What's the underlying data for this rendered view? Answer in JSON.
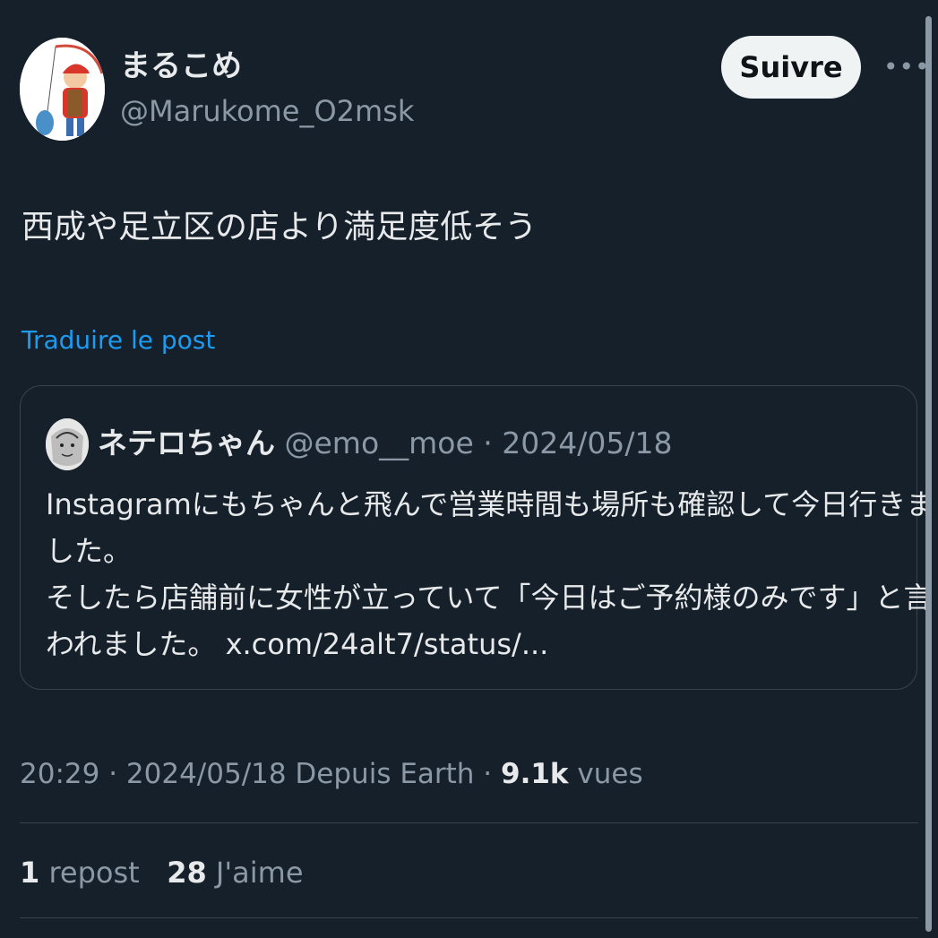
{
  "author": {
    "display_name": "まるこめ",
    "handle": "@Marukome_O2msk"
  },
  "follow_label": "Suivre",
  "more_icon": "more-horizontal-icon",
  "tweet": {
    "text": "西成や足立区の店より満足度低そう",
    "translate_label": "Traduire le post"
  },
  "quoted": {
    "display_name": "ネテロちゃん",
    "handle": "@emo__moe",
    "separator": " · ",
    "date": "2024/05/18",
    "lines": [
      "Instagramにもちゃんと飛んで営業時間も場所も確認して今日行きま",
      "した。",
      "そしたら店舗前に女性が立っていて「今日はご予約様のみです」と言",
      "われました。 x.com/24alt7/status/..."
    ]
  },
  "meta": {
    "time": "20:29",
    "separator": " · ",
    "date_source": "2024/05/18 Depuis Earth",
    "views_count": "9.1k",
    "views_label": "vues"
  },
  "stats": {
    "reposts_count": "1",
    "reposts_label": "repost",
    "likes_count": "28",
    "likes_label": "J'aime"
  },
  "colors": {
    "background": "#15202b",
    "primary_text": "#e7e9ea",
    "secondary_text": "#8b98a5",
    "link": "#1d9bf0",
    "border": "#38444d",
    "button_bg": "#eff3f4"
  }
}
